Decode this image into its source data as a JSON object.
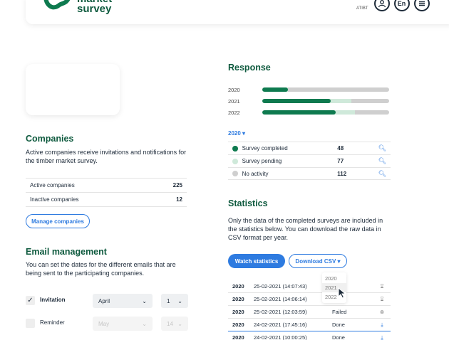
{
  "header": {
    "brand_line1": "market",
    "brand_line2": "survey",
    "user_label": "ATIBT",
    "user_icon": "user-icon",
    "language": "En",
    "menu_icon": "hamburger-menu-icon"
  },
  "companies": {
    "title": "Companies",
    "description": "Active companies receive invitations and notifications for the timber market survey.",
    "rows": [
      {
        "label": "Active companies",
        "value": "225"
      },
      {
        "label": "Inactive companies",
        "value": "12"
      }
    ],
    "manage_button": "Manage companies"
  },
  "email": {
    "title": "Email management",
    "description": "You can set the dates for the different emails that are being sent to the participating companies.",
    "rows": [
      {
        "label": "Invitation",
        "checked": true,
        "month": "April",
        "day": "1"
      },
      {
        "label": "Reminder",
        "checked": false,
        "month": "May",
        "day": "14"
      }
    ]
  },
  "response": {
    "title": "Response",
    "years": [
      {
        "label": "2020",
        "completed": 0.2,
        "pending": 0.2
      },
      {
        "label": "2021",
        "completed": 0.54,
        "pending": 0.7
      },
      {
        "label": "2022",
        "completed": 0.58,
        "pending": 0.73
      }
    ],
    "selected_year": "2020",
    "rows": [
      {
        "label": "Survey completed",
        "value": "48",
        "color": "#0e7a4f"
      },
      {
        "label": "Survey pending",
        "value": "77",
        "color": "#cfe9da"
      },
      {
        "label": "No activity",
        "value": "112",
        "color": "#cfcfcf"
      }
    ]
  },
  "statistics": {
    "title": "Statistics",
    "description": "Only the data of the completed surveys are included in the statistics below. You can download the raw data in CSV format per year.",
    "watch_button": "Watch statistics",
    "download_button": "Download CSV",
    "dropdown_options": [
      "2020",
      "2021",
      "2022"
    ],
    "rows": [
      {
        "year": "2020",
        "date": "25-02-2021 (14:07:43)",
        "status": "ed",
        "icon": "hourglass-icon"
      },
      {
        "year": "2020",
        "date": "25-02-2021 (14:06:14)",
        "status": "ssing",
        "icon": "hourglass-icon"
      },
      {
        "year": "2020",
        "date": "25-02-2021 (12:03:59)",
        "status": "Failed",
        "icon": "failed-icon"
      },
      {
        "year": "2020",
        "date": "24-02-2021 (17:45:16)",
        "status": "Done",
        "icon": "download-icon"
      },
      {
        "year": "2020",
        "date": "24-02-2021 (10:00:25)",
        "status": "Done",
        "icon": "download-icon"
      }
    ]
  }
}
